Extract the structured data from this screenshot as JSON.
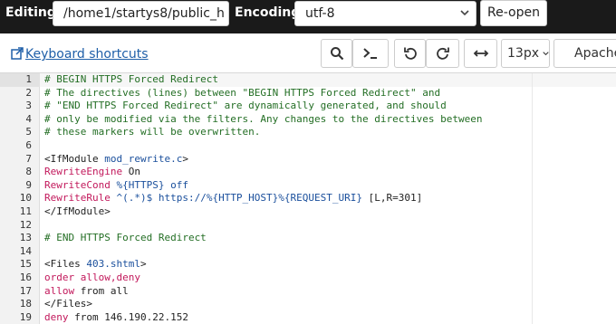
{
  "topbar": {
    "editing_label": "Editing:",
    "path": "/home1/startys8/public_h",
    "encoding_label": "Encoding:",
    "encoding_value": "utf-8",
    "reopen_label": "Re-open"
  },
  "toolbar": {
    "keyboard_shortcuts": "Keyboard shortcuts",
    "font_size": "13px",
    "mode": "Apache",
    "icons": [
      "search-icon",
      "terminal-icon",
      "undo-icon",
      "redo-icon",
      "wrap-icon",
      "chevron-down-icon"
    ]
  },
  "editor": {
    "active_line": 1,
    "lines": [
      {
        "n": "1",
        "tokens": [
          {
            "t": "comment",
            "v": "# BEGIN HTTPS Forced Redirect"
          }
        ]
      },
      {
        "n": "2",
        "tokens": [
          {
            "t": "comment",
            "v": "# The directives (lines) between \"BEGIN HTTPS Forced Redirect\" and"
          }
        ]
      },
      {
        "n": "3",
        "tokens": [
          {
            "t": "comment",
            "v": "# \"END HTTPS Forced Redirect\" are dynamically generated, and should"
          }
        ]
      },
      {
        "n": "4",
        "tokens": [
          {
            "t": "comment",
            "v": "# only be modified via the filters. Any changes to the directives between"
          }
        ]
      },
      {
        "n": "5",
        "tokens": [
          {
            "t": "comment",
            "v": "# these markers will be overwritten."
          }
        ]
      },
      {
        "n": "6",
        "tokens": []
      },
      {
        "n": "7",
        "tokens": [
          {
            "t": "tag",
            "v": "<IfModule "
          },
          {
            "t": "arg",
            "v": "mod_rewrite.c"
          },
          {
            "t": "tag",
            "v": ">"
          }
        ]
      },
      {
        "n": "8",
        "tokens": [
          {
            "t": "kw",
            "v": "RewriteEngine"
          },
          {
            "t": "plain",
            "v": " On"
          }
        ]
      },
      {
        "n": "9",
        "tokens": [
          {
            "t": "kw",
            "v": "RewriteCond"
          },
          {
            "t": "plain",
            "v": " "
          },
          {
            "t": "str",
            "v": "%{HTTPS} off"
          }
        ]
      },
      {
        "n": "10",
        "tokens": [
          {
            "t": "kw",
            "v": "RewriteRule"
          },
          {
            "t": "plain",
            "v": " "
          },
          {
            "t": "str",
            "v": "^(.*)$ https://%{HTTP_HOST}%{REQUEST_URI}"
          },
          {
            "t": "plain",
            "v": " [L,R=301]"
          }
        ]
      },
      {
        "n": "11",
        "tokens": [
          {
            "t": "tag",
            "v": "</IfModule>"
          }
        ]
      },
      {
        "n": "12",
        "tokens": []
      },
      {
        "n": "13",
        "tokens": [
          {
            "t": "comment",
            "v": "# END HTTPS Forced Redirect"
          }
        ]
      },
      {
        "n": "14",
        "tokens": []
      },
      {
        "n": "15",
        "tokens": [
          {
            "t": "tag",
            "v": "<Files "
          },
          {
            "t": "arg",
            "v": "403.shtml"
          },
          {
            "t": "tag",
            "v": ">"
          }
        ]
      },
      {
        "n": "16",
        "tokens": [
          {
            "t": "kw",
            "v": "order"
          },
          {
            "t": "plain",
            "v": " "
          },
          {
            "t": "kw",
            "v": "allow,deny"
          }
        ]
      },
      {
        "n": "17",
        "tokens": [
          {
            "t": "kw",
            "v": "allow"
          },
          {
            "t": "plain",
            "v": " from all"
          }
        ]
      },
      {
        "n": "18",
        "tokens": [
          {
            "t": "tag",
            "v": "</Files>"
          }
        ]
      },
      {
        "n": "19",
        "tokens": [
          {
            "t": "kw",
            "v": "deny"
          },
          {
            "t": "plain",
            "v": " from 146.190.22.152"
          }
        ]
      }
    ]
  },
  "colors": {
    "topbar_bg": "#1a1a1a",
    "link": "#1f5fa8",
    "comment": "#236e24",
    "keyword": "#c2185b",
    "string": "#1a4f9c"
  }
}
